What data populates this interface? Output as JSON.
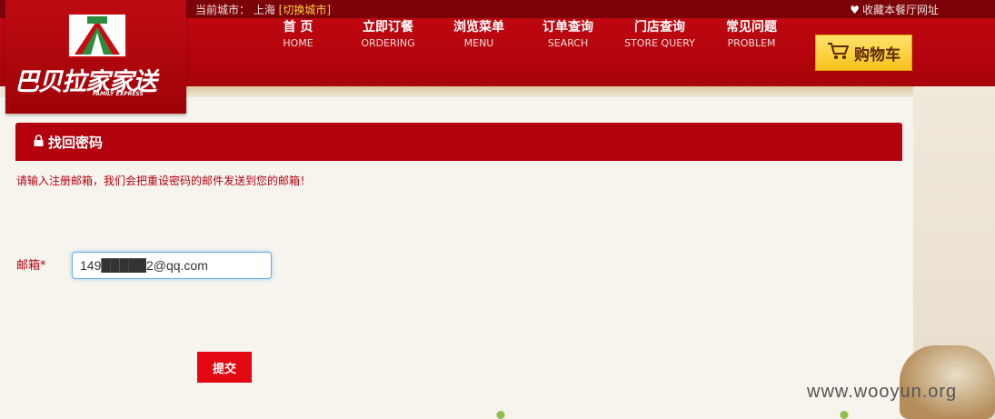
{
  "topbar": {
    "city_prefix": "当前城市：  上海",
    "switch_city": "[切换城市]",
    "favorite": "收藏本餐厅网址"
  },
  "logo": {
    "brand": "巴贝拉家家送",
    "brand_en": "FAMILY EXPRESS"
  },
  "nav": {
    "items": [
      {
        "zh": "首  页",
        "en": "HOME"
      },
      {
        "zh": "立即订餐",
        "en": "ORDERING"
      },
      {
        "zh": "浏览菜单",
        "en": "MENU"
      },
      {
        "zh": "订单查询",
        "en": "SEARCH"
      },
      {
        "zh": "门店查询",
        "en": "STORE QUERY"
      },
      {
        "zh": "常见问题",
        "en": "PROBLEM"
      }
    ],
    "cart_label": "购物车"
  },
  "panel": {
    "title": "找回密码",
    "hint": "请输入注册邮箱，我们会把重设密码的邮件发送到您的邮箱！",
    "email_label": "邮箱*",
    "email_value": "149█████2@qq.com",
    "submit_label": "提交"
  },
  "watermark": "www.wooyun.org",
  "colors": {
    "brand_red": "#b3010d",
    "topbar": "#7b0208",
    "cart_yellow": "#f7c21d",
    "submit_red": "#e30613"
  }
}
